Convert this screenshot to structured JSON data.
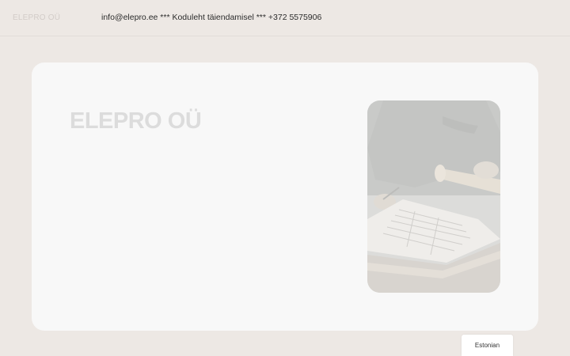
{
  "header": {
    "brand": "ELEPRO OÜ",
    "contact": "info@elepro.ee *** Koduleht täiendamisel *** +372 5575906"
  },
  "hero": {
    "title": "ELEPRO OÜ",
    "image": "person-drafting-electrical-plans-photo"
  },
  "language": {
    "label": "Estonian"
  }
}
